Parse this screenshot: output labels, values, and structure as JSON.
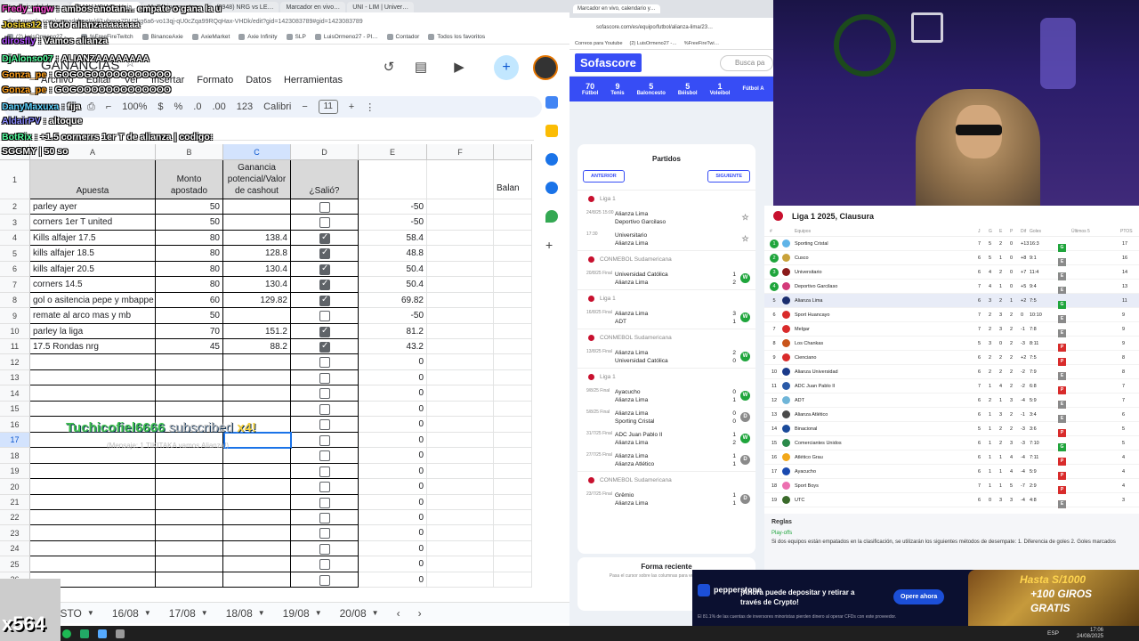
{
  "left_browser": {
    "tabs": [
      "La mejor del dass…",
      "GANANCIAS - Hoja…",
      "M. Espinoza, etan…",
      "(3948) NRG vs LE…",
      "Marcador en vivo…",
      "UNI - LIM | Univer…"
    ],
    "url": "docs.google.com/spreadsheets/d/1yhqoa7DUZkg6a6-vo13qj-qU0cZqa99RQqHax-VHDk/edit?gid=1423083789#gid=1423083789",
    "bookmarks": [
      "(2) LuisOrmeno27 -…",
      "%FreeFireTwitch",
      "BinanceAxie",
      "AxieMarket",
      "Axie Infinity",
      "SLP",
      "LuisOrmeno27 - Pl…",
      "Contador",
      "Todos los favoritos"
    ]
  },
  "sheets": {
    "title": "GANANCIAS",
    "menu": [
      "Archivo",
      "Editar",
      "Ver",
      "Insertar",
      "Formato",
      "Datos",
      "Herramientas"
    ],
    "toolbar": {
      "zoom": "100%",
      "currency": "$",
      "percent": "%",
      "dec_less": ".0",
      "dec_more": ".00",
      "format": "123",
      "font": "Calibri",
      "font_size": "11"
    },
    "col_headers": [
      "A",
      "B",
      "C",
      "D",
      "E",
      "F"
    ],
    "header_row": {
      "a": "Apuesta",
      "b": "Monto apostado",
      "c": "Ganancia potencial/Valor de cashout",
      "d": "¿Salió?",
      "g": "Balan"
    },
    "rows": [
      {
        "n": "2",
        "a": "parley ayer",
        "b": "50",
        "c": "",
        "d": false,
        "e": "-50"
      },
      {
        "n": "3",
        "a": "corners 1er T united",
        "b": "50",
        "c": "",
        "d": false,
        "e": "-50"
      },
      {
        "n": "4",
        "a": "Kills alfajer 17.5",
        "b": "80",
        "c": "138.4",
        "d": true,
        "e": "58.4"
      },
      {
        "n": "5",
        "a": "kills alfajer 18.5",
        "b": "80",
        "c": "128.8",
        "d": true,
        "e": "48.8"
      },
      {
        "n": "6",
        "a": "kills alfajer 20.5",
        "b": "80",
        "c": "130.4",
        "d": true,
        "e": "50.4"
      },
      {
        "n": "7",
        "a": "corners 14.5",
        "b": "80",
        "c": "130.4",
        "d": true,
        "e": "50.4"
      },
      {
        "n": "8",
        "a": "gol o asitencia pepe y mbappe",
        "b": "60",
        "c": "129.82",
        "d": true,
        "e": "69.82"
      },
      {
        "n": "9",
        "a": "remate al arco mas y mb",
        "b": "50",
        "c": "",
        "d": false,
        "e": "-50"
      },
      {
        "n": "10",
        "a": "parley la liga",
        "b": "70",
        "c": "151.2",
        "d": true,
        "e": "81.2"
      },
      {
        "n": "11",
        "a": "17.5 Rondas nrg",
        "b": "45",
        "c": "88.2",
        "d": true,
        "e": "43.2"
      },
      {
        "n": "12",
        "a": "",
        "b": "",
        "c": "",
        "d": false,
        "e": "0"
      },
      {
        "n": "13",
        "a": "",
        "b": "",
        "c": "",
        "d": false,
        "e": "0"
      },
      {
        "n": "14",
        "a": "",
        "b": "",
        "c": "",
        "d": false,
        "e": "0"
      },
      {
        "n": "15",
        "a": "",
        "b": "",
        "c": "",
        "d": false,
        "e": "0"
      },
      {
        "n": "16",
        "a": "",
        "b": "",
        "c": "",
        "d": false,
        "e": "0"
      },
      {
        "n": "17",
        "a": "",
        "b": "",
        "c": "",
        "d": false,
        "e": "0"
      },
      {
        "n": "18",
        "a": "",
        "b": "",
        "c": "",
        "d": false,
        "e": "0"
      },
      {
        "n": "19",
        "a": "",
        "b": "",
        "c": "",
        "d": false,
        "e": "0"
      },
      {
        "n": "20",
        "a": "",
        "b": "",
        "c": "",
        "d": false,
        "e": "0"
      },
      {
        "n": "21",
        "a": "",
        "b": "",
        "c": "",
        "d": false,
        "e": "0"
      },
      {
        "n": "22",
        "a": "",
        "b": "",
        "c": "",
        "d": false,
        "e": "0"
      },
      {
        "n": "23",
        "a": "",
        "b": "",
        "c": "",
        "d": false,
        "e": "0"
      },
      {
        "n": "24",
        "a": "",
        "b": "",
        "c": "",
        "d": false,
        "e": "0"
      },
      {
        "n": "25",
        "a": "",
        "b": "",
        "c": "",
        "d": false,
        "e": "0"
      },
      {
        "n": "26",
        "a": "",
        "b": "",
        "c": "",
        "d": false,
        "e": "0"
      }
    ],
    "sheet_tabs": [
      "AGOSTO",
      "16/08",
      "17/08",
      "18/08",
      "19/08",
      "20/08"
    ]
  },
  "chat": [
    {
      "user": "Fredy_mgw",
      "msg": ": ambos anotan… empate o gana la u",
      "color": "#ff4fd8"
    },
    {
      "user": "Josias12",
      "msg": ": todo alianzaaaaaaaa",
      "color": "#ffdd33"
    },
    {
      "user": "dirosfly",
      "msg": ": Vamos alianza",
      "color": "#b04fff"
    },
    {
      "user": "DjAlonso07",
      "msg": ": ALIANZAAAAAAAA",
      "color": "#54ff9f"
    },
    {
      "user": "Gonza_pe",
      "msg": ": GOGOGOOOOOOOOOOO",
      "color": "#ff9f1a"
    },
    {
      "user": "Gonza_pe",
      "msg": ": GOGOOOOOOOOOOOOO",
      "color": "#ff9f1a"
    },
    {
      "user": "DanyMaxuxa",
      "msg": ": fija",
      "color": "#5fd3ff"
    },
    {
      "user": "AldairPV",
      "msg": ": altoque",
      "color": "#8a8aff"
    },
    {
      "user": "BotRix",
      "msg": ": +1.5 cornerrs 1er T de alianza | codigo:",
      "color": "#54ff9f"
    },
    {
      "user": "",
      "msg": "SGGMY | 50 so",
      "color": "#ffffff"
    }
  ],
  "alert": {
    "name": "Tuchicofiel6666",
    "text": "subscribed",
    "mult": "x4!",
    "sub": "(Mensaje: 1 TIKITAKA vamos Alianza!)"
  },
  "cat_label": "x564",
  "sofascore": {
    "tabs": [
      "Marcador en vivo, calendario y…"
    ],
    "url": "sofascore.com/es/equipo/futbol/alianza-lima/23…",
    "bookmarks": [
      "Correos para Youtube",
      "(2) LuisOrmeno27 -…",
      "%FreeFireTwi…"
    ],
    "logo": "Sofascore",
    "search": "Busca pa",
    "sports": [
      {
        "n": "70",
        "l": "Fútbol"
      },
      {
        "n": "9",
        "l": "Tenis"
      },
      {
        "n": "5",
        "l": "Baloncesto"
      },
      {
        "n": "5",
        "l": "Béisbol"
      },
      {
        "n": "1",
        "l": "Voleibol"
      },
      {
        "n": "",
        "l": "Fútbol A"
      }
    ],
    "partidos_title": "Partidos",
    "anterior": "ANTERIOR",
    "siguiente": "SIGUIENTE",
    "groups": [
      {
        "league": "Liga 1",
        "matches": [
          {
            "date": "24/8/25 15:00",
            "h": "Alianza Lima",
            "a": "Deportivo Garcilaso",
            "sh": "",
            "sa": "",
            "res": ""
          },
          {
            "date": "17:30",
            "h": "Universitario",
            "a": "Alianza Lima",
            "sh": "",
            "sa": "",
            "res": ""
          }
        ]
      },
      {
        "league": "CONMEBOL Sudamericana",
        "matches": [
          {
            "date": "20/8/25 Final",
            "h": "Universidad Católica",
            "a": "Alianza Lima",
            "sh": "1",
            "sa": "2",
            "res": "W"
          }
        ]
      },
      {
        "league": "Liga 1",
        "matches": [
          {
            "date": "16/8/25 Final",
            "h": "Alianza Lima",
            "a": "ADT",
            "sh": "3",
            "sa": "1",
            "res": "W"
          }
        ]
      },
      {
        "league": "CONMEBOL Sudamericana",
        "matches": [
          {
            "date": "13/8/25 Final",
            "h": "Alianza Lima",
            "a": "Universidad Católica",
            "sh": "2",
            "sa": "0",
            "res": "W"
          }
        ]
      },
      {
        "league": "Liga 1",
        "matches": [
          {
            "date": "9/8/25 Final",
            "h": "Ayacucho",
            "a": "Alianza Lima",
            "sh": "0",
            "sa": "1",
            "res": "W"
          },
          {
            "date": "5/8/25 Final",
            "h": "Alianza Lima",
            "a": "Sporting Cristal",
            "sh": "0",
            "sa": "0",
            "res": "D"
          },
          {
            "date": "31/7/25 Final",
            "h": "ADC Juan Pablo II",
            "a": "Alianza Lima",
            "sh": "1",
            "sa": "2",
            "res": "W"
          },
          {
            "date": "27/7/25 Final",
            "h": "Alianza Lima",
            "a": "Alianza Atlético",
            "sh": "1",
            "sa": "1",
            "res": "D"
          }
        ]
      },
      {
        "league": "CONMEBOL Sudamericana",
        "matches": [
          {
            "date": "23/7/25 Final",
            "h": "Grêmio",
            "a": "Alianza Lima",
            "sh": "1",
            "sa": "1",
            "res": "D"
          }
        ]
      }
    ],
    "forma_title": "Forma reciente",
    "forma_sub": "Pasa el cursor sobre las columnas para ver los resultados"
  },
  "standings": {
    "title": "Liga 1 2025, Clausura",
    "cols": [
      "#",
      "Equipos",
      "J",
      "G",
      "E",
      "P",
      "Dif",
      "Goles",
      "Últimos 5",
      "PTOS"
    ],
    "rows": [
      {
        "p": "1",
        "t": "Sporting Cristal",
        "j": "7",
        "g": "5",
        "e": "2",
        "pp": "0",
        "d": "+13",
        "gl": "16:3",
        "f": "GGGEG",
        "pts": "17",
        "c": "#5fb4e8"
      },
      {
        "p": "2",
        "t": "Cusco",
        "j": "6",
        "g": "5",
        "e": "1",
        "pp": "0",
        "d": "+8",
        "gl": "9:1",
        "f": "GGGGE",
        "pts": "16",
        "c": "#c9a23a"
      },
      {
        "p": "3",
        "t": "Universitario",
        "j": "6",
        "g": "4",
        "e": "2",
        "pp": "0",
        "d": "+7",
        "gl": "11:4",
        "f": "GGEGE",
        "pts": "14",
        "c": "#8b1a1a"
      },
      {
        "p": "4",
        "t": "Deportivo Garcilaso",
        "j": "7",
        "g": "4",
        "e": "1",
        "pp": "0",
        "d": "+5",
        "gl": "9:4",
        "f": "GEGGE",
        "pts": "13",
        "c": "#d33a7a"
      },
      {
        "p": "5",
        "t": "Alianza Lima",
        "j": "6",
        "g": "3",
        "e": "2",
        "pp": "1",
        "d": "+2",
        "gl": "7:5",
        "f": "GEGEG",
        "pts": "11",
        "c": "#1a2d6e"
      },
      {
        "p": "6",
        "t": "Sport Huancayo",
        "j": "7",
        "g": "2",
        "e": "3",
        "pp": "2",
        "d": "0",
        "gl": "10:10",
        "f": "PGPEE",
        "pts": "9",
        "c": "#d92b2b"
      },
      {
        "p": "7",
        "t": "Melgar",
        "j": "7",
        "g": "2",
        "e": "3",
        "pp": "2",
        "d": "-1",
        "gl": "7:8",
        "f": "GEPGE",
        "pts": "9",
        "c": "#d92b2b"
      },
      {
        "p": "8",
        "t": "Los Chankas",
        "j": "5",
        "g": "3",
        "e": "0",
        "pp": "2",
        "d": "-3",
        "gl": "8:11",
        "f": "PGEGP",
        "pts": "9",
        "c": "#c9541a"
      },
      {
        "p": "9",
        "t": "Cienciano",
        "j": "6",
        "g": "2",
        "e": "2",
        "pp": "2",
        "d": "+2",
        "gl": "7:5",
        "f": "GEPEP",
        "pts": "8",
        "c": "#d92b2b"
      },
      {
        "p": "10",
        "t": "Alianza Universidad",
        "j": "6",
        "g": "2",
        "e": "2",
        "pp": "2",
        "d": "-2",
        "gl": "7:9",
        "f": "GPEPE",
        "pts": "8",
        "c": "#1a3a8a"
      },
      {
        "p": "11",
        "t": "ADC Juan Pablo II",
        "j": "7",
        "g": "1",
        "e": "4",
        "pp": "2",
        "d": "-2",
        "gl": "6:8",
        "f": "GEEEP",
        "pts": "7",
        "c": "#2a5aa8"
      },
      {
        "p": "12",
        "t": "ADT",
        "j": "6",
        "g": "2",
        "e": "1",
        "pp": "3",
        "d": "-4",
        "gl": "5:9",
        "f": "PPGPE",
        "pts": "7",
        "c": "#6fb5d8"
      },
      {
        "p": "13",
        "t": "Alianza Atlético",
        "j": "6",
        "g": "1",
        "e": "3",
        "pp": "2",
        "d": "-1",
        "gl": "3:4",
        "f": "EGPEE",
        "pts": "6",
        "c": "#4a4a4a"
      },
      {
        "p": "14",
        "t": "Binacional",
        "j": "5",
        "g": "1",
        "e": "2",
        "pp": "2",
        "d": "-3",
        "gl": "3:6",
        "f": "GEPEP",
        "pts": "5",
        "c": "#1a4a9a"
      },
      {
        "p": "15",
        "t": "Comerciantes Unidos",
        "j": "6",
        "g": "1",
        "e": "2",
        "pp": "3",
        "d": "-3",
        "gl": "7:10",
        "f": "EEPPG",
        "pts": "5",
        "c": "#2a8a4a"
      },
      {
        "p": "16",
        "t": "Atlético Grau",
        "j": "6",
        "g": "1",
        "e": "1",
        "pp": "4",
        "d": "-4",
        "gl": "7:11",
        "f": "PGEPP",
        "pts": "4",
        "c": "#f2a81a"
      },
      {
        "p": "17",
        "t": "Ayacucho",
        "j": "6",
        "g": "1",
        "e": "1",
        "pp": "4",
        "d": "-4",
        "gl": "5:9",
        "f": "PGPEP",
        "pts": "4",
        "c": "#1a4ab0"
      },
      {
        "p": "18",
        "t": "Sport Boys",
        "j": "7",
        "g": "1",
        "e": "1",
        "pp": "5",
        "d": "-7",
        "gl": "2:9",
        "f": "EPPGP",
        "pts": "4",
        "c": "#ec6fb0"
      },
      {
        "p": "19",
        "t": "UTC",
        "j": "6",
        "g": "0",
        "e": "3",
        "pp": "3",
        "d": "-4",
        "gl": "4:8",
        "f": "EEPPE",
        "pts": "3",
        "c": "#3a6a2a"
      }
    ],
    "reglas_title": "Reglas",
    "playoffs": "Play-offs",
    "reglas_text": "Si dos equipos están empatados en la clasificación, se utilizarán los siguientes métodos de desempate: 1. Diferencia de goles 2. Goles marcados"
  },
  "ad": {
    "brand": "pepperstone",
    "msg": "¡Ahora puede depositar y retirar a través de Crypto!",
    "button": "Opere ahora",
    "disclaimer": "El 81.1% de las cuentas de inversores minoristas pierden dinero al operar CFDs con este proveedor.",
    "promo1": "Hasta S/1000",
    "promo2": "+100 GIROS",
    "promo3": "GRATIS"
  },
  "taskbar": {
    "lang": "ESP",
    "time": "17:06",
    "date": "24/08/2025"
  }
}
